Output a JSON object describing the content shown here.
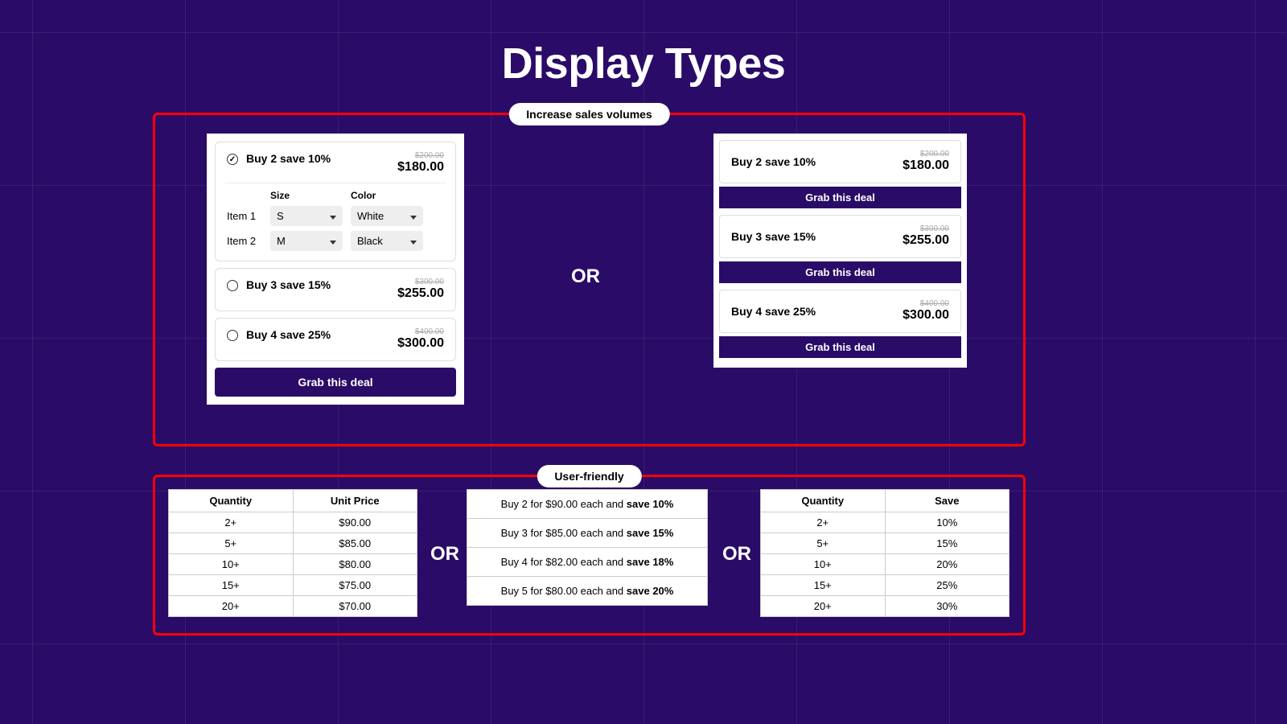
{
  "title": "Display Types",
  "sections": {
    "top_label": "Increase sales volumes",
    "bottom_label": "User-friendly"
  },
  "connector": "OR",
  "left_card": {
    "options": [
      {
        "label": "Buy 2 save 10%",
        "old": "$200.00",
        "price": "$180.00",
        "checked": true
      },
      {
        "label": "Buy 3 save 15%",
        "old": "$300.00",
        "price": "$255.00",
        "checked": false
      },
      {
        "label": "Buy 4 save 25%",
        "old": "$400.00",
        "price": "$300.00",
        "checked": false
      }
    ],
    "variant_headers": {
      "size": "Size",
      "color": "Color"
    },
    "items": [
      {
        "name": "Item 1",
        "size": "S",
        "color": "White"
      },
      {
        "name": "Item 2",
        "size": "M",
        "color": "Black"
      }
    ],
    "button": "Grab this deal"
  },
  "right_card": {
    "tiles": [
      {
        "label": "Buy 2 save 10%",
        "old": "$200.00",
        "price": "$180.00"
      },
      {
        "label": "Buy 3 save 15%",
        "old": "$300.00",
        "price": "$255.00"
      },
      {
        "label": "Buy 4 save 25%",
        "old": "$400.00",
        "price": "$300.00"
      }
    ],
    "button": "Grab this deal"
  },
  "table_qty_price": {
    "headers": [
      "Quantity",
      "Unit Price"
    ],
    "rows": [
      [
        "2+",
        "$90.00"
      ],
      [
        "5+",
        "$85.00"
      ],
      [
        "10+",
        "$80.00"
      ],
      [
        "15+",
        "$75.00"
      ],
      [
        "20+",
        "$70.00"
      ]
    ]
  },
  "sentence_list": {
    "rows": [
      {
        "pre": "Buy 2 for $90.00 each and ",
        "bold": "save 10%"
      },
      {
        "pre": "Buy 3 for $85.00 each and ",
        "bold": "save 15%"
      },
      {
        "pre": "Buy 4 for $82.00 each and ",
        "bold": "save 18%"
      },
      {
        "pre": "Buy 5 for $80.00 each and ",
        "bold": "save 20%"
      }
    ]
  },
  "table_qty_save": {
    "headers": [
      "Quantity",
      "Save"
    ],
    "rows": [
      [
        "2+",
        "10%"
      ],
      [
        "5+",
        "15%"
      ],
      [
        "10+",
        "20%"
      ],
      [
        "15+",
        "25%"
      ],
      [
        "20+",
        "30%"
      ]
    ]
  }
}
